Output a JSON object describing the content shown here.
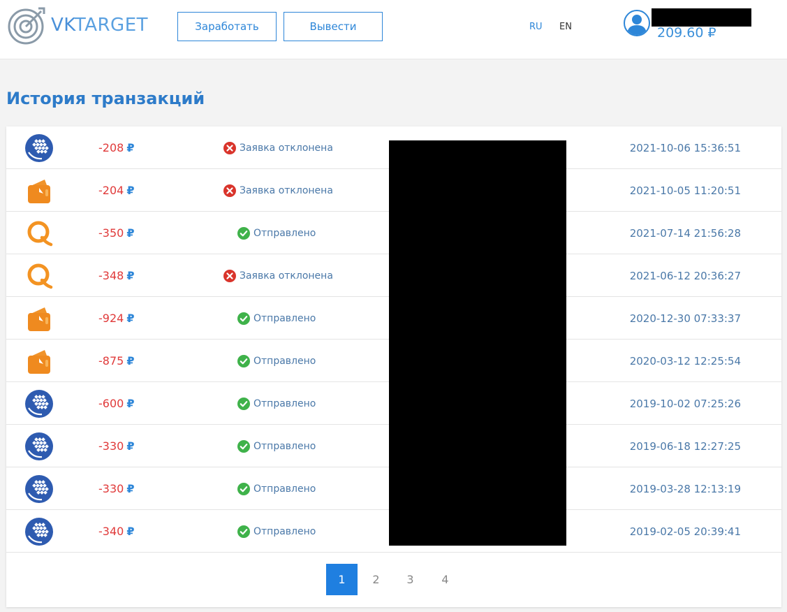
{
  "header": {
    "logo_text_vk": "VK",
    "logo_text_target": "TARGET",
    "earn_label": "Заработать",
    "withdraw_label": "Вывести",
    "lang_ru": "RU",
    "lang_en": "EN",
    "balance": "209.60 ₽"
  },
  "title": "История транзакций",
  "colors": {
    "accent": "#2d86d8",
    "negative": "#e03a3a",
    "ok": "#3fb24a",
    "rejected": "#d9342b"
  },
  "transactions": [
    {
      "method": "webmoney-icon",
      "amount": "-208",
      "currency": "₽",
      "status": "Заявка отклонена",
      "status_type": "rejected",
      "date": "2021-10-06 15:36:51"
    },
    {
      "method": "yandex-money-icon",
      "amount": "-204",
      "currency": "₽",
      "status": "Заявка отклонена",
      "status_type": "rejected",
      "date": "2021-10-05 11:20:51"
    },
    {
      "method": "qiwi-icon",
      "amount": "-350",
      "currency": "₽",
      "status": "Отправлено",
      "status_type": "ok",
      "date": "2021-07-14 21:56:28"
    },
    {
      "method": "qiwi-icon",
      "amount": "-348",
      "currency": "₽",
      "status": "Заявка отклонена",
      "status_type": "rejected",
      "date": "2021-06-12 20:36:27"
    },
    {
      "method": "yandex-money-icon",
      "amount": "-924",
      "currency": "₽",
      "status": "Отправлено",
      "status_type": "ok",
      "date": "2020-12-30 07:33:37"
    },
    {
      "method": "yandex-money-icon",
      "amount": "-875",
      "currency": "₽",
      "status": "Отправлено",
      "status_type": "ok",
      "date": "2020-03-12 12:25:54"
    },
    {
      "method": "webmoney-icon",
      "amount": "-600",
      "currency": "₽",
      "status": "Отправлено",
      "status_type": "ok",
      "date": "2019-10-02 07:25:26"
    },
    {
      "method": "webmoney-icon",
      "amount": "-330",
      "currency": "₽",
      "status": "Отправлено",
      "status_type": "ok",
      "date": "2019-06-18 12:27:25"
    },
    {
      "method": "webmoney-icon",
      "amount": "-330",
      "currency": "₽",
      "status": "Отправлено",
      "status_type": "ok",
      "date": "2019-03-28 12:13:19"
    },
    {
      "method": "webmoney-icon",
      "amount": "-340",
      "currency": "₽",
      "status": "Отправлено",
      "status_type": "ok",
      "date": "2019-02-05 20:39:41"
    }
  ],
  "pagination": {
    "pages": [
      "1",
      "2",
      "3",
      "4"
    ],
    "current": "1"
  }
}
